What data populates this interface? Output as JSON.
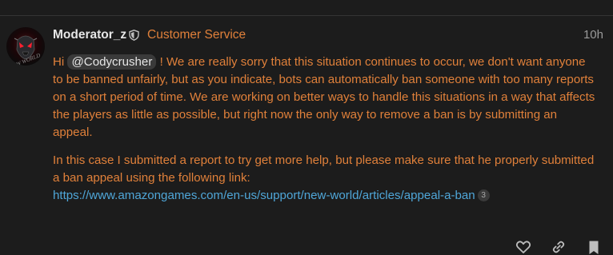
{
  "post": {
    "username": "Moderator_z",
    "user_title": "Customer Service",
    "date": "10h",
    "paragraph1": {
      "greeting": "Hi",
      "mention": "@Codycrusher",
      "text": "! We are really sorry that this situation continues to occur, we don't want anyone to be banned unfairly, but as you indicate, bots can automatically ban someone with too many reports on a short period of time. We are working on better ways to handle this situations in a way that affects the players as little as possible, but right now the only way to remove a ban is by submitting an appeal."
    },
    "paragraph2": {
      "text": "In this case I submitted a report to try get more help, but please make sure that he properly submitted a ban appeal using the following link:",
      "link_text": "https://www.amazongames.com/en-us/support/new-world/articles/appeal-a-ban",
      "link_clicks": "3"
    },
    "avatar_watermark": "NEW WORLD"
  },
  "icons": {
    "moderator_badge": "shield-icon",
    "like": "heart-icon",
    "share": "link-icon",
    "bookmark": "bookmark-icon"
  },
  "colors": {
    "background": "#1c1c1c",
    "accent_orange": "#e0803a",
    "link_blue": "#4fa6d8",
    "username": "#e6e6e6",
    "muted": "#9a9a9a"
  }
}
